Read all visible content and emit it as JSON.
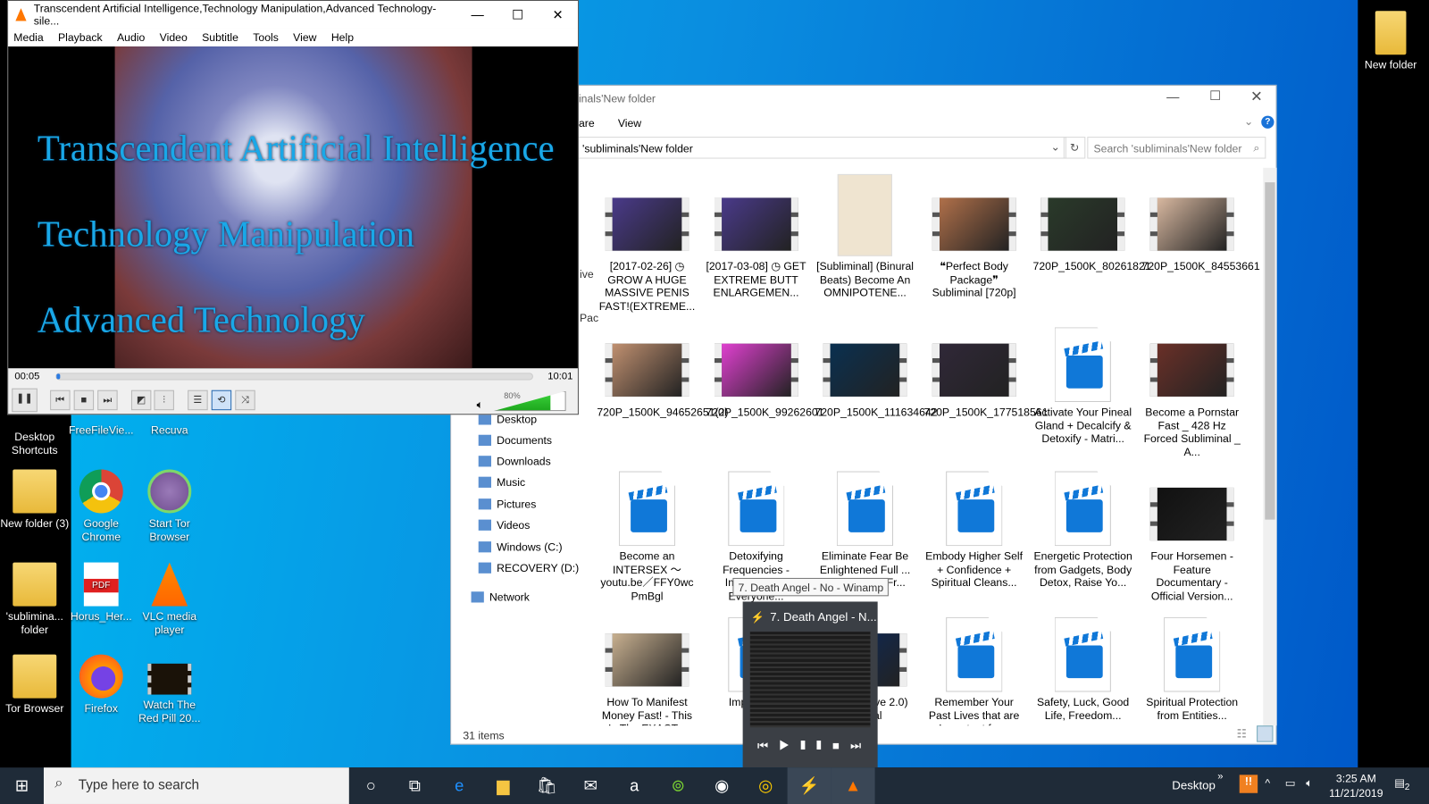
{
  "vlc": {
    "title": "Transcendent Artificial Intelligence,Technology Manipulation,Advanced Technology-sile...",
    "menu": [
      "Media",
      "Playback",
      "Audio",
      "Video",
      "Subtitle",
      "Tools",
      "View",
      "Help"
    ],
    "video_lines": [
      "Transcendent Artificial Intelligence",
      "Technology Manipulation",
      "Advanced Technology"
    ],
    "elapsed": "00:05",
    "duration": "10:01",
    "progress_fraction": 0.008,
    "volume": "80%",
    "volume_fraction": 0.8
  },
  "explorer": {
    "title": "inals'New folder",
    "tabs": [
      "are",
      "View"
    ],
    "address": "'subliminals'New folder",
    "search_placeholder": "Search 'subliminals'New folder",
    "nav_partial": [
      "ive",
      "Pac"
    ],
    "nav": [
      "Desktop",
      "Documents",
      "Downloads",
      "Music",
      "Pictures",
      "Videos",
      "Windows (C:)",
      "RECOVERY (D:)",
      "Network"
    ],
    "status": "31 items",
    "files": [
      {
        "label": "[2017-02-26] ◷ GROW A HUGE MASSIVE PENIS FAST!(EXTREME...",
        "type": "video",
        "color": "#4a3a8a"
      },
      {
        "label": "[2017-03-08] ◷ GET EXTREME BUTT ENLARGEMEN...",
        "type": "video",
        "color": "#4a3a8a"
      },
      {
        "label": "[Subliminal] (Binural Beats) Become An OMNIPOTENE...",
        "type": "image",
        "color": "#efe4d0"
      },
      {
        "label": "❝Perfect Body Package❞ Subliminal [720p]",
        "type": "video",
        "color": "#b0704a"
      },
      {
        "label": "720P_1500K_80261821",
        "type": "video",
        "color": "#2a3a2a"
      },
      {
        "label": "720P_1500K_84553661",
        "type": "video",
        "color": "#d8b8a0"
      },
      {
        "label": "720P_1500K_94652651(2)",
        "type": "video",
        "color": "#c09070"
      },
      {
        "label": "720P_1500K_99262601",
        "type": "video",
        "color": "#e040d0"
      },
      {
        "label": "720P_1500K_111634642",
        "type": "video",
        "color": "#0a3050"
      },
      {
        "label": "720P_1500K_177518561",
        "type": "video",
        "color": "#302838"
      },
      {
        "label": "Activate Your Pineal Gland + Decalcify & Detoxify - Matri...",
        "type": "file"
      },
      {
        "label": "Become a Pornstar Fast _ 428 Hz Forced Subliminal _ A...",
        "type": "video",
        "color": "#6a3028"
      },
      {
        "label": "Become an INTERSEX ～ youtu.be／FFY0wc PmBgl",
        "type": "file"
      },
      {
        "label": "Detoxifying Frequencies - Important for Everyone...",
        "type": "file"
      },
      {
        "label": "Eliminate Fear Be Enlightened Full ... Subliminals, Fr...",
        "type": "file"
      },
      {
        "label": "Embody Higher Self + Confidence + Spiritual Cleans...",
        "type": "file"
      },
      {
        "label": "Energetic Protection from Gadgets, Body Detox, Raise Yo...",
        "type": "file"
      },
      {
        "label": "Four Horsemen - Feature Documentary - Official Version...",
        "type": "video",
        "color": "#111"
      },
      {
        "label": "How To Manifest Money Fast! - This Is The EXACT...",
        "type": "video",
        "color": "#c8b090"
      },
      {
        "label": "Imp... Me...",
        "type": "file"
      },
      {
        "label": "...ing DJ ...ve 2.0) ...fficial",
        "type": "video",
        "color": "#0a2a60"
      },
      {
        "label": "Remember Your Past Lives that are Important for...",
        "type": "file"
      },
      {
        "label": "Safety, Luck, Good Life, Freedom...",
        "type": "file"
      },
      {
        "label": "Spiritual Protection from Entities...",
        "type": "file"
      }
    ]
  },
  "winamp": {
    "tooltip": "7. Death Angel - No - Winamp",
    "preview_title": "7. Death Angel - N..."
  },
  "desktop": {
    "icons": [
      "Desktop Shortcuts",
      "FreeFileVie...",
      "Recuva",
      "New folder (3)",
      "Google Chrome",
      "Start Tor Browser",
      "'sublimina... folder",
      "Horus_Her...",
      "VLC media player",
      "Tor Browser",
      "Firefox",
      "Watch The Red Pill 20..."
    ],
    "right_icon": "New folder"
  },
  "taskbar": {
    "search_placeholder": "Type here to search",
    "desktop_label": "Desktop",
    "time": "3:25 AM",
    "date": "11/21/2019",
    "notifications": "2"
  }
}
